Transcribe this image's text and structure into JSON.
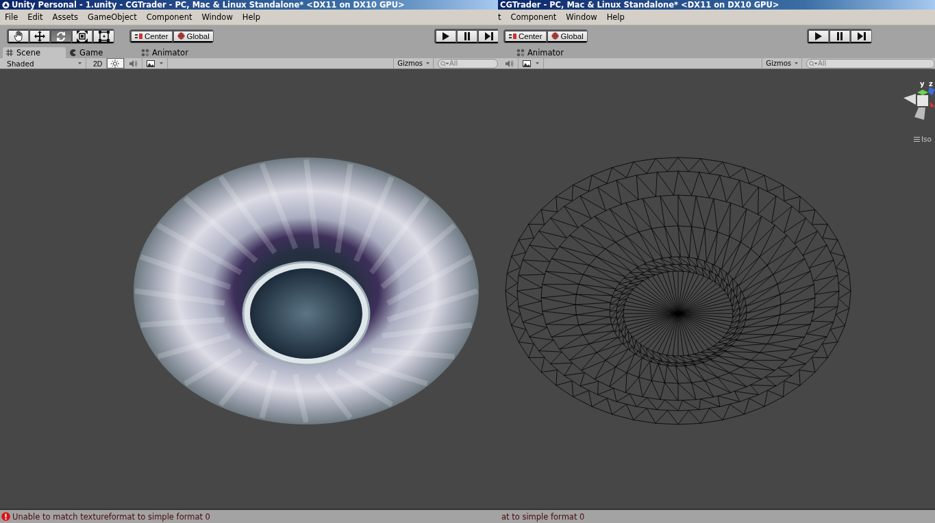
{
  "panes": [
    {
      "title": "Unity Personal - 1.unity - CGTrader - PC, Mac & Linux Standalone* <DX11 on DX10 GPU>",
      "app_icon": true,
      "menu": [
        "File",
        "Edit",
        "Assets",
        "GameObject",
        "Component",
        "Window",
        "Help"
      ],
      "tools": [
        {
          "kind": "hand",
          "selected": false
        },
        {
          "kind": "move",
          "selected": false
        },
        {
          "kind": "rotate",
          "selected": true
        },
        {
          "kind": "scale",
          "selected": false
        },
        {
          "kind": "rect",
          "selected": false
        }
      ],
      "pivot": [
        {
          "kind": "center",
          "label": "Center"
        },
        {
          "kind": "global",
          "label": "Global"
        }
      ],
      "play": [
        {
          "kind": "play"
        },
        {
          "kind": "pause"
        },
        {
          "kind": "step"
        }
      ],
      "tabs": [
        {
          "kind": "scene",
          "label": "Scene",
          "selected": true
        },
        {
          "kind": "game",
          "label": "Game",
          "selected": false
        },
        {
          "kind": "animator",
          "label": "Animator",
          "selected": false
        }
      ],
      "scene_toolbar": [
        {
          "kind": "dropdown",
          "label": "Shaded"
        },
        {
          "kind": "text",
          "label": "2D",
          "selected": false
        },
        {
          "kind": "sun",
          "selected": true
        },
        {
          "kind": "audio",
          "selected": false
        },
        {
          "kind": "image",
          "selected": false
        }
      ],
      "gizmos": "Gizmos",
      "search": {
        "placeholder": "All"
      },
      "viewport": {
        "kind": "shaded"
      },
      "status": {
        "text": "Unable to match textureformat to simple format 0",
        "error": true
      }
    },
    {
      "title": "CGTrader - PC, Mac & Linux Standalone* <DX11 on DX10 GPU>",
      "menu": [
        "t",
        "Component",
        "Window",
        "Help"
      ],
      "pivot": [
        {
          "kind": "center",
          "label": "Center"
        },
        {
          "kind": "global",
          "label": "Global"
        }
      ],
      "play": [
        {
          "kind": "play"
        },
        {
          "kind": "pause"
        },
        {
          "kind": "step"
        }
      ],
      "tabs": [
        {
          "kind": "animator",
          "label": "Animator",
          "selected": false
        }
      ],
      "scene_toolbar": [
        {
          "kind": "audio",
          "selected": false
        },
        {
          "kind": "image",
          "selected": false
        }
      ],
      "gizmos": "Gizmos",
      "search": {
        "placeholder": "All"
      },
      "viewport": {
        "kind": "wireframe",
        "gizmo": {
          "axes": [
            "y",
            "z"
          ],
          "projection": "Iso"
        }
      },
      "status": {
        "text": "at to simple format 0"
      }
    }
  ]
}
